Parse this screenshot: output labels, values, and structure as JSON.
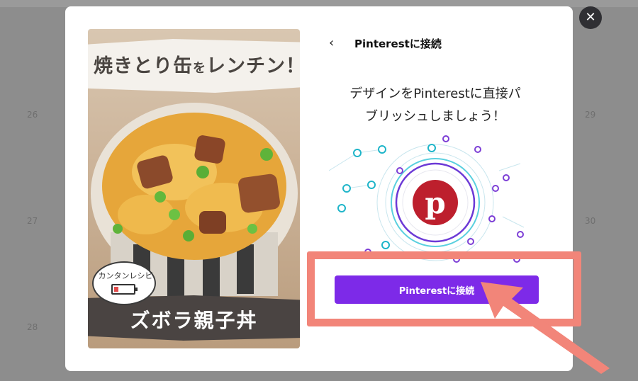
{
  "background": {
    "numbers": [
      "26",
      "27",
      "28",
      "29",
      "30"
    ]
  },
  "close": {
    "icon": "close-icon",
    "symbol": "✕"
  },
  "pin": {
    "headline_main": "焼きとり缶",
    "headline_particle": "を",
    "headline_end": "レンチン！",
    "bubble_text": "カンタンレシピ",
    "subtitle": "ズボラ親子丼"
  },
  "panel": {
    "back_symbol": "‹",
    "title": "Pinterestに接続",
    "description_line1": "デザインをPinterestに直接パ",
    "description_line2": "ブリッシュしましょう！",
    "logo_icon": "pinterest-logo-icon",
    "connect_label": "Pinterestに接続"
  },
  "colors": {
    "accent": "#7d2ae8",
    "pinterest_red": "#bd1f2d",
    "annotation": "#f28579",
    "dot_teal": "#1fb5c9",
    "dot_purple": "#7d3fd6"
  }
}
